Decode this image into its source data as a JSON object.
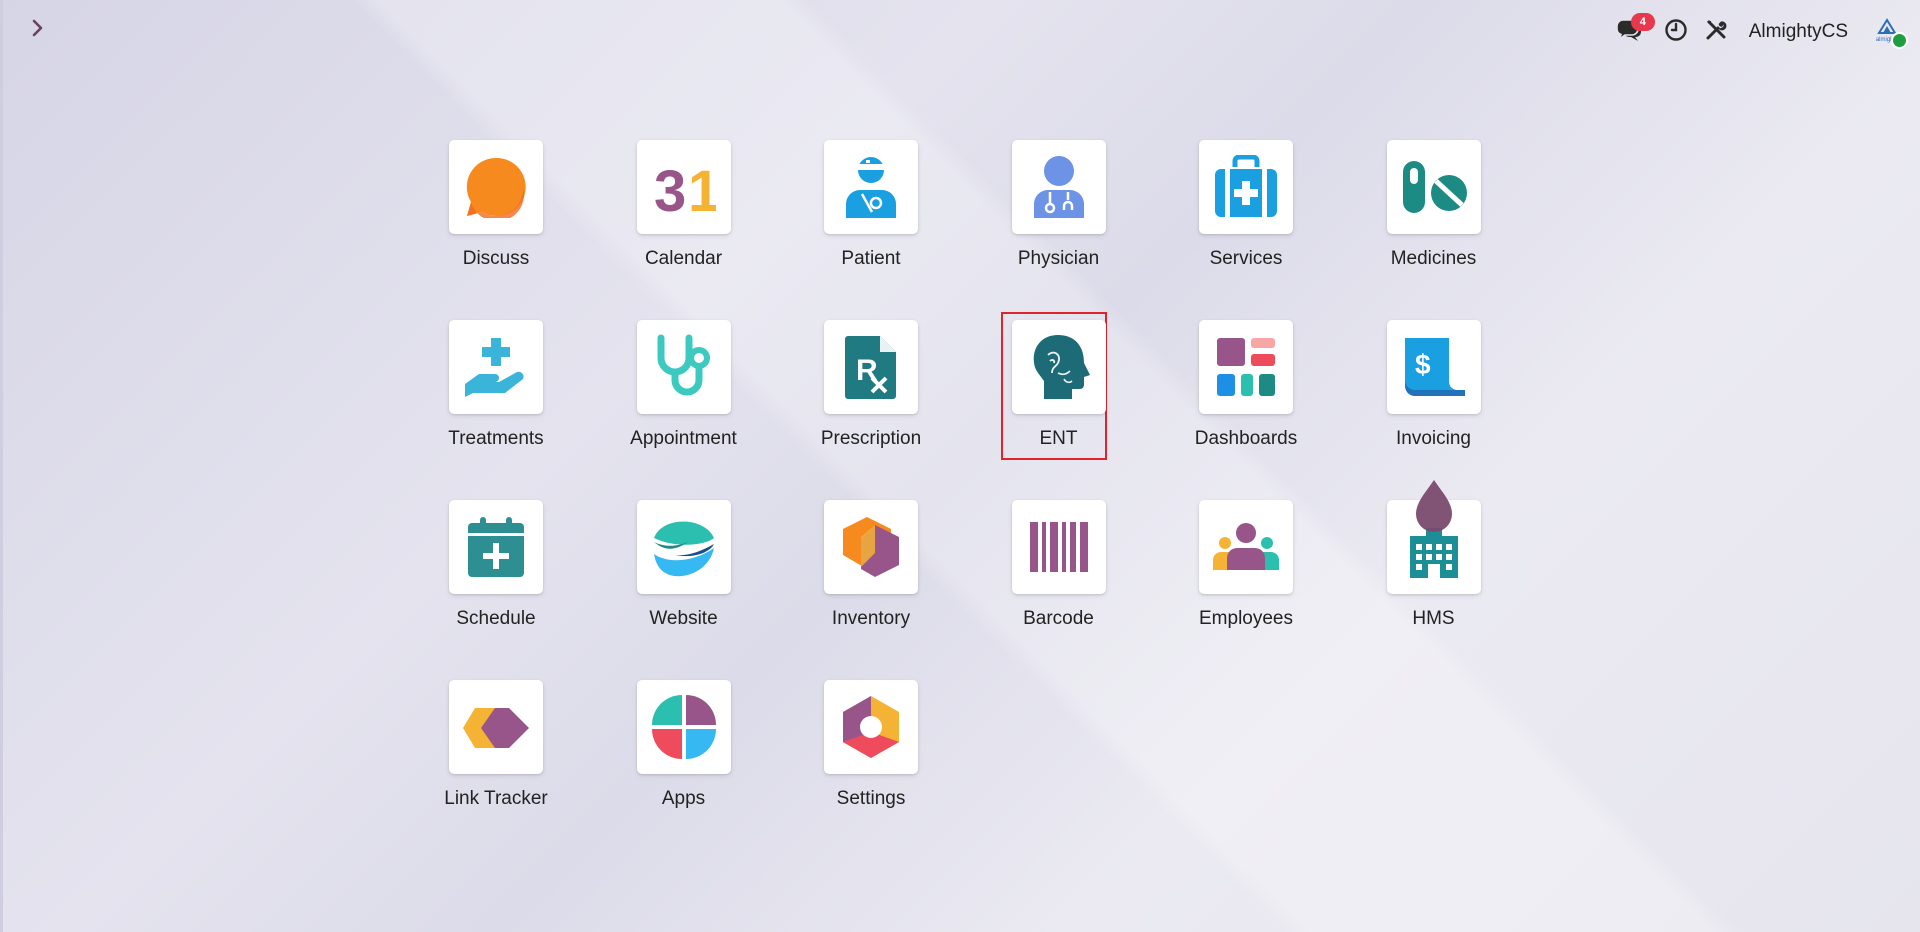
{
  "topbar": {
    "messages_badge": "4",
    "company_name": "AlmightyCS",
    "avatar_text": "almighty"
  },
  "apps": [
    {
      "label": "Discuss",
      "icon": "discuss-icon"
    },
    {
      "label": "Calendar",
      "icon": "calendar-icon",
      "icon_text": "31"
    },
    {
      "label": "Patient",
      "icon": "patient-icon"
    },
    {
      "label": "Physician",
      "icon": "physician-icon"
    },
    {
      "label": "Services",
      "icon": "services-icon"
    },
    {
      "label": "Medicines",
      "icon": "medicines-icon"
    },
    {
      "label": "Treatments",
      "icon": "treatments-icon"
    },
    {
      "label": "Appointment",
      "icon": "appointment-icon"
    },
    {
      "label": "Prescription",
      "icon": "prescription-icon"
    },
    {
      "label": "ENT",
      "icon": "ent-icon",
      "selected": true
    },
    {
      "label": "Dashboards",
      "icon": "dashboards-icon"
    },
    {
      "label": "Invoicing",
      "icon": "invoicing-icon",
      "icon_text": "$"
    },
    {
      "label": "Schedule",
      "icon": "schedule-icon"
    },
    {
      "label": "Website",
      "icon": "website-icon"
    },
    {
      "label": "Inventory",
      "icon": "inventory-icon"
    },
    {
      "label": "Barcode",
      "icon": "barcode-icon"
    },
    {
      "label": "Employees",
      "icon": "employees-icon"
    },
    {
      "label": "HMS",
      "icon": "hms-icon"
    },
    {
      "label": "Link Tracker",
      "icon": "link-tracker-icon"
    },
    {
      "label": "Apps",
      "icon": "apps-icon"
    },
    {
      "label": "Settings",
      "icon": "settings-icon"
    }
  ],
  "colors": {
    "badge": "#e8384d",
    "selection": "#e0242b",
    "online": "#1e9e3e"
  }
}
